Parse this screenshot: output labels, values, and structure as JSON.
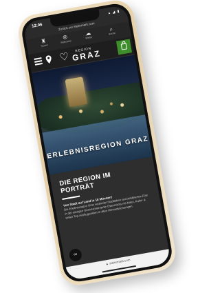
{
  "status": {
    "time": "12:06",
    "icons": "▴ ◢ ▮"
  },
  "browser": {
    "back_link": "Zurück zur steiermark.com"
  },
  "topnav": [
    {
      "label": "Touren",
      "icon": "hiking-icon",
      "glyph": "♜"
    },
    {
      "label": "Webcams",
      "icon": "webcam-icon",
      "glyph": "⦾"
    },
    {
      "label": "Wetter",
      "icon": "weather-icon",
      "glyph": "☁"
    },
    {
      "label": "Suche",
      "icon": "search-icon",
      "glyph": "⌕"
    }
  ],
  "header": {
    "logo_region": "REGION",
    "logo_graz": "GRAZ",
    "logo_heart": "♡"
  },
  "hero": {
    "title": "ERLEBNISREGION GRAZ"
  },
  "portrait": {
    "title": "DIE REGION IM PORTRÄT",
    "lead": "Von Stadt auf Land in 10 Minuten!",
    "body": "Die Erlebnisregion Graz verbindet Stadtleben und städtisches Flair in der einzigen Genussmetropole Österreichs mit Natur, Kultur & vielen Top-Ausflugszielen in allen Himmelsrichtungen."
  },
  "chat": {
    "glyph": "∞"
  },
  "bottombar": {
    "url": "▲ steiermark.com"
  },
  "colors": {
    "accent_green": "#3e8e2b",
    "phone_gold": "#e5cfa6"
  }
}
